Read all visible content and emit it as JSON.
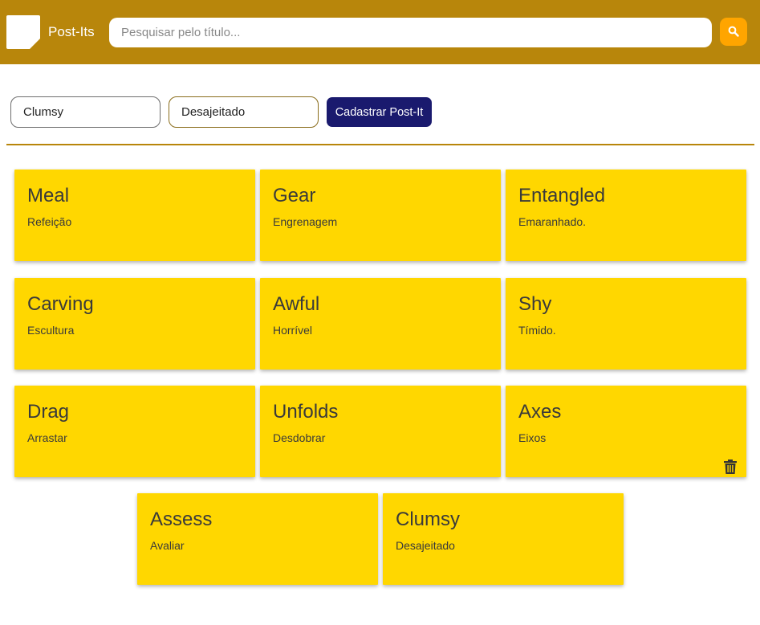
{
  "header": {
    "brand": "Post-Its",
    "search_placeholder": "Pesquisar pelo título...",
    "search_value": "",
    "icon": "search-icon",
    "color": "#b8860b",
    "search_button_color": "#ffa500"
  },
  "form": {
    "title_value": "Clumsy",
    "description_value": "Desajeitado",
    "submit_label": "Cadastrar Post-It",
    "submit_color": "#1a1a6e"
  },
  "notes": [
    {
      "title": "Meal",
      "description": "Refeição"
    },
    {
      "title": "Gear",
      "description": "Engrenagem"
    },
    {
      "title": "Entangled",
      "description": "Emaranhado."
    },
    {
      "title": "Carving",
      "description": "Escultura"
    },
    {
      "title": "Awful",
      "description": "Horrível"
    },
    {
      "title": "Shy",
      "description": "Tímido."
    },
    {
      "title": "Drag",
      "description": "Arrastar"
    },
    {
      "title": "Unfolds",
      "description": "Desdobrar"
    },
    {
      "title": "Axes",
      "description": "Eixos",
      "hovered": true
    },
    {
      "title": "Assess",
      "description": "Avaliar"
    },
    {
      "title": "Clumsy",
      "description": "Desajeitado"
    }
  ],
  "note_color": "#ffd700",
  "delete_icon": "trash-icon"
}
